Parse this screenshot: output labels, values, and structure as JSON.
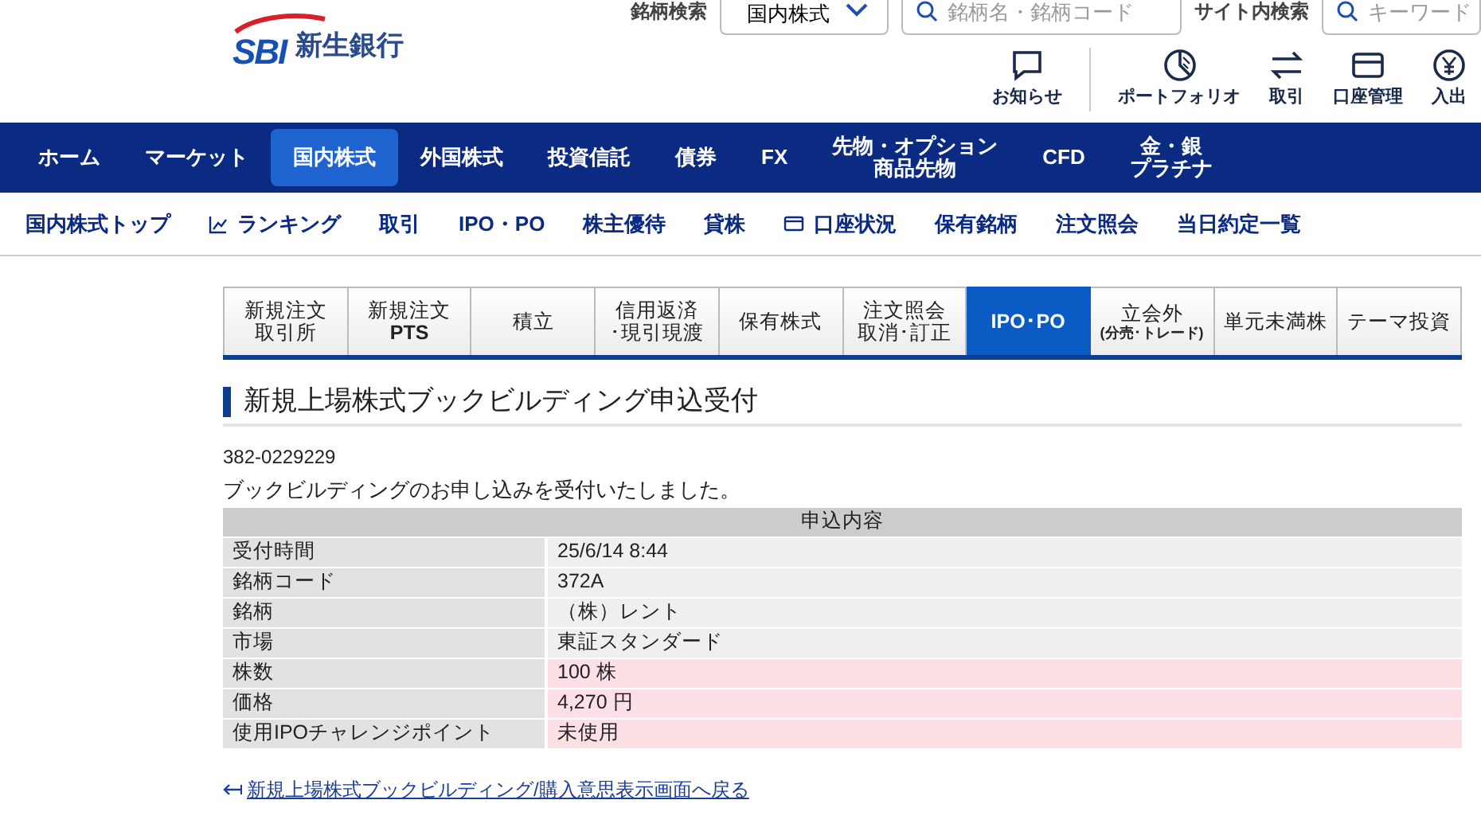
{
  "header": {
    "logo": {
      "brand": "SBI",
      "name": "新生銀行"
    },
    "search": {
      "label": "銘柄検索",
      "market": "国内株式",
      "placeholder": "銘柄名・銘柄コード"
    },
    "site_search": {
      "label": "サイト内検索",
      "placeholder": "キーワード"
    },
    "utilities": [
      {
        "kind": "chat",
        "label": "お知らせ"
      },
      {
        "kind": "pie",
        "label": "ポートフォリオ"
      },
      {
        "kind": "arrows",
        "label": "取引"
      },
      {
        "kind": "card",
        "label": "口座管理"
      },
      {
        "kind": "coin",
        "label": "入出"
      }
    ]
  },
  "main_nav": [
    {
      "label": "ホーム",
      "selected": false
    },
    {
      "label": "マーケット",
      "selected": false
    },
    {
      "label": "国内株式",
      "selected": true
    },
    {
      "label": "外国株式",
      "selected": false
    },
    {
      "label": "投資信託",
      "selected": false
    },
    {
      "label": "債券",
      "selected": false
    },
    {
      "label": "FX",
      "selected": false
    },
    {
      "lines": [
        "先物・オプション",
        "商品先物"
      ],
      "selected": false
    },
    {
      "label": "CFD",
      "selected": false
    },
    {
      "lines": [
        "金・銀",
        "プラチナ"
      ],
      "selected": false
    }
  ],
  "sub_nav": [
    {
      "label": "国内株式トップ"
    },
    {
      "label": "ランキング",
      "kind": "chart"
    },
    {
      "label": "取引"
    },
    {
      "label": "IPO・PO"
    },
    {
      "label": "株主優待"
    },
    {
      "label": "貸株"
    },
    {
      "label": "口座状況",
      "kind": "card"
    },
    {
      "label": "保有銘柄"
    },
    {
      "label": "注文照会"
    },
    {
      "label": "当日約定一覧"
    }
  ],
  "tabs": [
    {
      "lines": [
        "新規注文",
        "取引所"
      ],
      "kind": "standard",
      "selected": false
    },
    {
      "lines": [
        "新規注文",
        "PTS"
      ],
      "kind": "bold-sub",
      "selected": false
    },
    {
      "lines": [
        "積立"
      ],
      "kind": "standard",
      "selected": false
    },
    {
      "lines": [
        "信用返済",
        "･現引現渡"
      ],
      "kind": "standard",
      "selected": false
    },
    {
      "lines": [
        "保有株式"
      ],
      "kind": "standard",
      "selected": false
    },
    {
      "lines": [
        "注文照会",
        "取消･訂正"
      ],
      "kind": "standard",
      "selected": false
    },
    {
      "lines": [
        "IPO･PO"
      ],
      "kind": "bold",
      "selected": true
    },
    {
      "lines": [
        "立会外",
        "(分売･トレード)"
      ],
      "kind": "note-sub",
      "selected": false
    },
    {
      "lines": [
        "単元未満株"
      ],
      "kind": "standard",
      "selected": false
    },
    {
      "lines": [
        "テーマ投資"
      ],
      "kind": "standard",
      "selected": false
    }
  ],
  "page_title": "新規上場株式ブックビルディング申込受付",
  "receipt_number": "382-0229229",
  "message": "ブックビルディングのお申し込みを受付いたしました。",
  "table": {
    "caption": "申込内容",
    "rows": [
      {
        "label": "受付時間",
        "value": "25/6/14 8:44",
        "highlighted": false
      },
      {
        "label": "銘柄コード",
        "value": "372A",
        "highlighted": false
      },
      {
        "label": "銘柄",
        "value": "（株）レント",
        "highlighted": false
      },
      {
        "label": "市場",
        "value": "東証スタンダード",
        "highlighted": false
      },
      {
        "label": "株数",
        "value": "100 株",
        "highlighted": true
      },
      {
        "label": "価格",
        "value": "4,270 円",
        "highlighted": true
      },
      {
        "label": "使用IPOチャレンジポイント",
        "value": "未使用",
        "highlighted": true
      }
    ]
  },
  "back_link": "新規上場株式ブックビルディング/購入意思表示画面へ戻る"
}
